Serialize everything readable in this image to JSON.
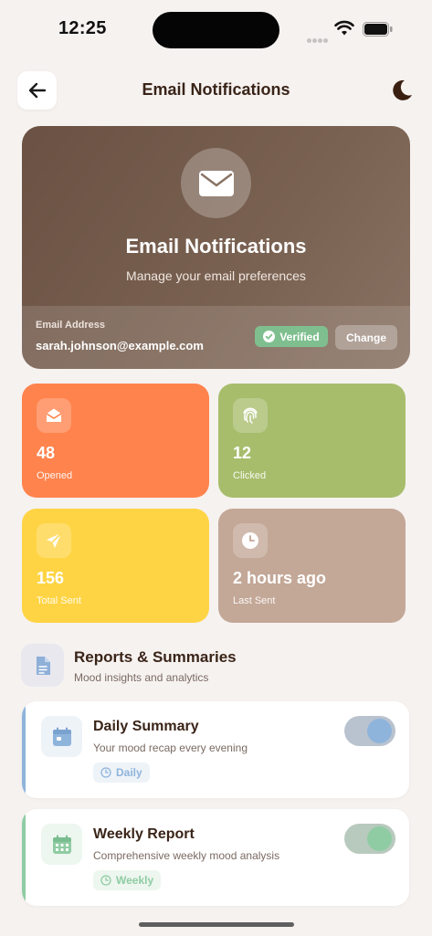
{
  "status_bar": {
    "time": "12:25"
  },
  "header": {
    "title": "Email Notifications",
    "back_icon": "arrow-left-icon",
    "theme_icon": "moon-icon"
  },
  "hero": {
    "icon": "envelope-icon",
    "title": "Email Notifications",
    "subtitle": "Manage your email preferences",
    "email_label": "Email Address",
    "email_value": "sarah.johnson@example.com",
    "verified_label": "Verified",
    "change_label": "Change"
  },
  "stats": [
    {
      "icon": "envelope-open-icon",
      "value": "48",
      "label": "Opened",
      "color": "#ff834d"
    },
    {
      "icon": "fingerprint-icon",
      "value": "12",
      "label": "Clicked",
      "color": "#a7bd6c"
    },
    {
      "icon": "paper-plane-icon",
      "value": "156",
      "label": "Total Sent",
      "color": "#ffd444"
    },
    {
      "icon": "clock-icon",
      "value": "2 hours ago",
      "label": "Last Sent",
      "color": "#c3a797"
    }
  ],
  "section": {
    "icon": "document-icon",
    "title": "Reports & Summaries",
    "subtitle": "Mood insights and analytics"
  },
  "cards": [
    {
      "icon": "calendar-icon",
      "title": "Daily Summary",
      "subtitle": "Your mood recap every evening",
      "badge": "Daily",
      "enabled": true,
      "accent": "#8fb4dc"
    },
    {
      "icon": "calendar-grid-icon",
      "title": "Weekly Report",
      "subtitle": "Comprehensive weekly mood analysis",
      "badge": "Weekly",
      "enabled": true,
      "accent": "#8fcca3"
    }
  ]
}
